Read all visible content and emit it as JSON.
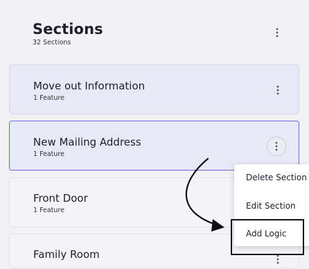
{
  "header": {
    "title": "Sections",
    "subtitle": "32 Sections"
  },
  "sections": [
    {
      "name": "Move out Information",
      "features": "1 Feature"
    },
    {
      "name": "New Mailing Address",
      "features": "1 Feature"
    },
    {
      "name": "Front Door",
      "features": "1 Feature"
    },
    {
      "name": "Family Room",
      "features": ""
    }
  ],
  "context_menu": {
    "items": [
      "Delete Section",
      "Edit Section",
      "Add Logic"
    ]
  },
  "icons": {
    "more": "more-vertical-icon",
    "annotation": "curved-arrow-icon"
  },
  "colors": {
    "selected_border": "#6a6ec8",
    "card_bg": "#e8e8f6",
    "highlight_box": "#111111"
  }
}
